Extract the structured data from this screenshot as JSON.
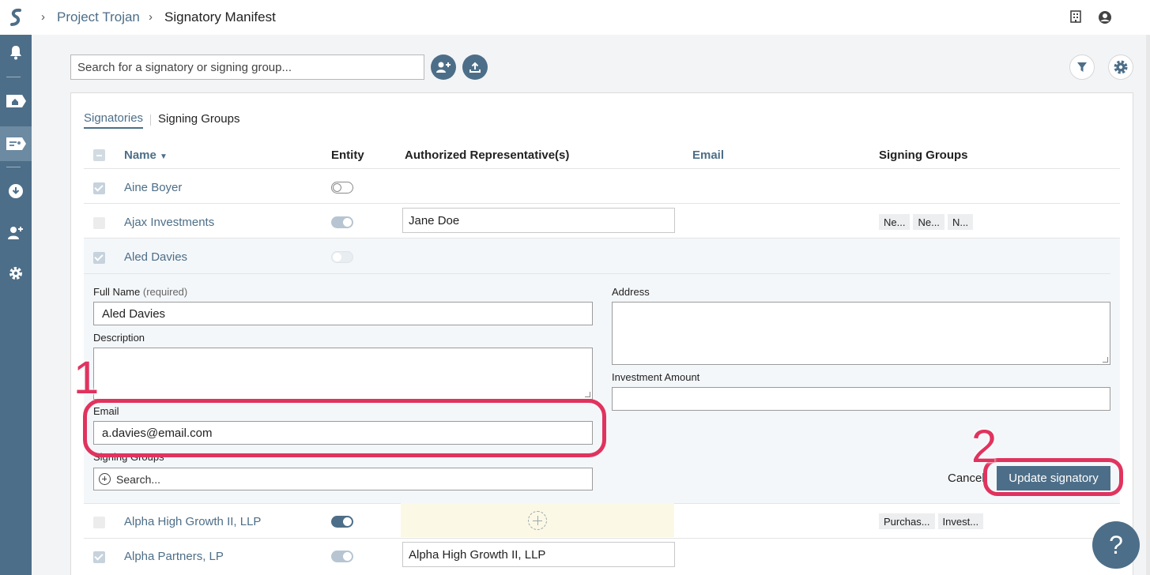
{
  "breadcrumb": {
    "project": "Project Trojan",
    "current": "Signatory Manifest"
  },
  "toolbar": {
    "search_placeholder": "Search for a signatory or signing group...",
    "add_signatory_icon": "add-user-icon",
    "upload_icon": "upload-icon",
    "filter_icon": "filter-icon",
    "settings_icon": "gear-icon"
  },
  "tabs": {
    "signatories": "Signatories",
    "signing_groups": "Signing Groups"
  },
  "columns": {
    "name": "Name",
    "entity": "Entity",
    "reps": "Authorized Representative(s)",
    "email": "Email",
    "signing_groups": "Signing Groups"
  },
  "rows": [
    {
      "name": "Aine Boyer",
      "checked": true,
      "entity": "off",
      "rep": "",
      "groups": []
    },
    {
      "name": "Ajax Investments",
      "checked": false,
      "entity": "on-disabled",
      "rep": "Jane Doe",
      "groups": [
        "Ne...",
        "Ne...",
        "N..."
      ]
    },
    {
      "name": "Aled Davies",
      "checked": true,
      "entity": "off-disabled",
      "rep": "",
      "groups": []
    },
    {
      "name": "Alpha High Growth II, LLP",
      "checked": false,
      "entity": "on",
      "rep": "",
      "groups": [
        "Purchas...",
        "Invest..."
      ]
    },
    {
      "name": "Alpha Partners, LP",
      "checked": true,
      "entity": "on-disabled",
      "rep": "Alpha High Growth II, LLP",
      "groups": []
    }
  ],
  "edit_form": {
    "full_name_label": "Full Name",
    "full_name_req": "(required)",
    "full_name_value": "Aled Davies",
    "description_label": "Description",
    "email_label": "Email",
    "email_value": "a.davies@email.com",
    "signing_groups_label": "Signing Groups",
    "signing_groups_placeholder": "Search...",
    "address_label": "Address",
    "investment_label": "Investment Amount",
    "cancel_label": "Cancel",
    "update_label": "Update signatory"
  },
  "annotations": {
    "step1": "1",
    "step2": "2",
    "color": "#e0335e"
  },
  "help_label": "?",
  "brand_color": "#4d6e88"
}
